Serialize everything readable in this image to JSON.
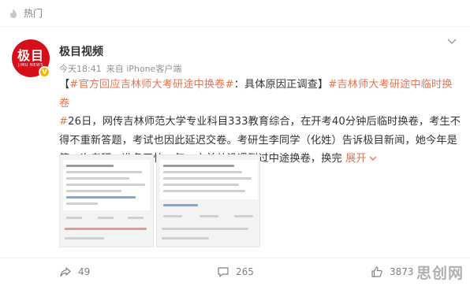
{
  "topbar": {
    "label": "热门",
    "icon": "hot-icon"
  },
  "post": {
    "avatar": {
      "logo_cn": "极目",
      "logo_en": "JIMU NEWS",
      "badge": "V"
    },
    "author": "极目视频",
    "time": "今天18:41",
    "source": "来自 iPhone客户端",
    "content": {
      "bracket_open": "【",
      "topic1": "#官方回应吉林师大考研途中换卷#",
      "title_text": "：具体原因正调查",
      "bracket_close": "】",
      "topic2": "#吉林师大考研途中临时换卷",
      "topic2_end": "#",
      "body": "26日，网传吉林师范大学专业科目333教育综合，在开考40分钟后临时换卷，考生不得不重新答题，考试也因此延迟交卷。考研生李同学（化姓）告诉极目新闻，她今年是第二次考研，准备了快一年。之前从没遇到过中途换卷，换完",
      "expand": "展开",
      "expand_icon": "chevron-down-icon"
    },
    "actions": {
      "share_count": "49",
      "comment_count": "265",
      "like_count": "3873"
    }
  },
  "watermark": "思创网",
  "colors": {
    "accent": "#eb7350",
    "avatar_bg": "#d60f1a",
    "badge": "#f7b500"
  }
}
